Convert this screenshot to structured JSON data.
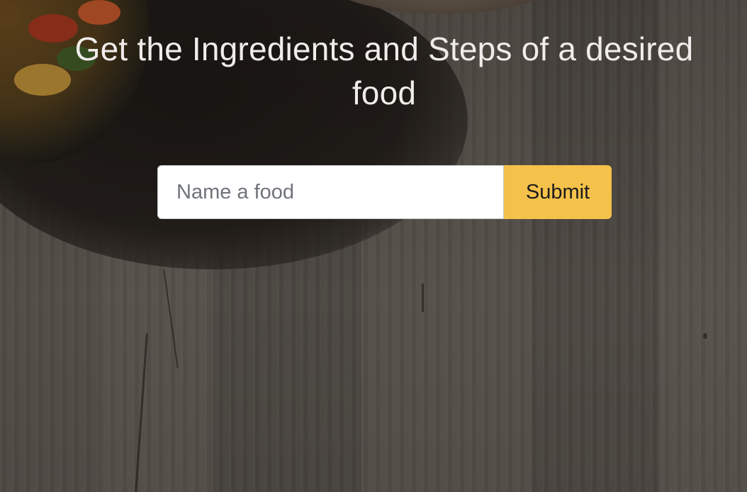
{
  "hero": {
    "title": "Get the Ingredients and Steps of a desired food"
  },
  "search": {
    "placeholder": "Name a food",
    "value": "",
    "submit_label": "Submit"
  },
  "colors": {
    "submit_button": "#f4c14a",
    "title_text": "#f0ecea",
    "input_background": "#ffffff"
  }
}
